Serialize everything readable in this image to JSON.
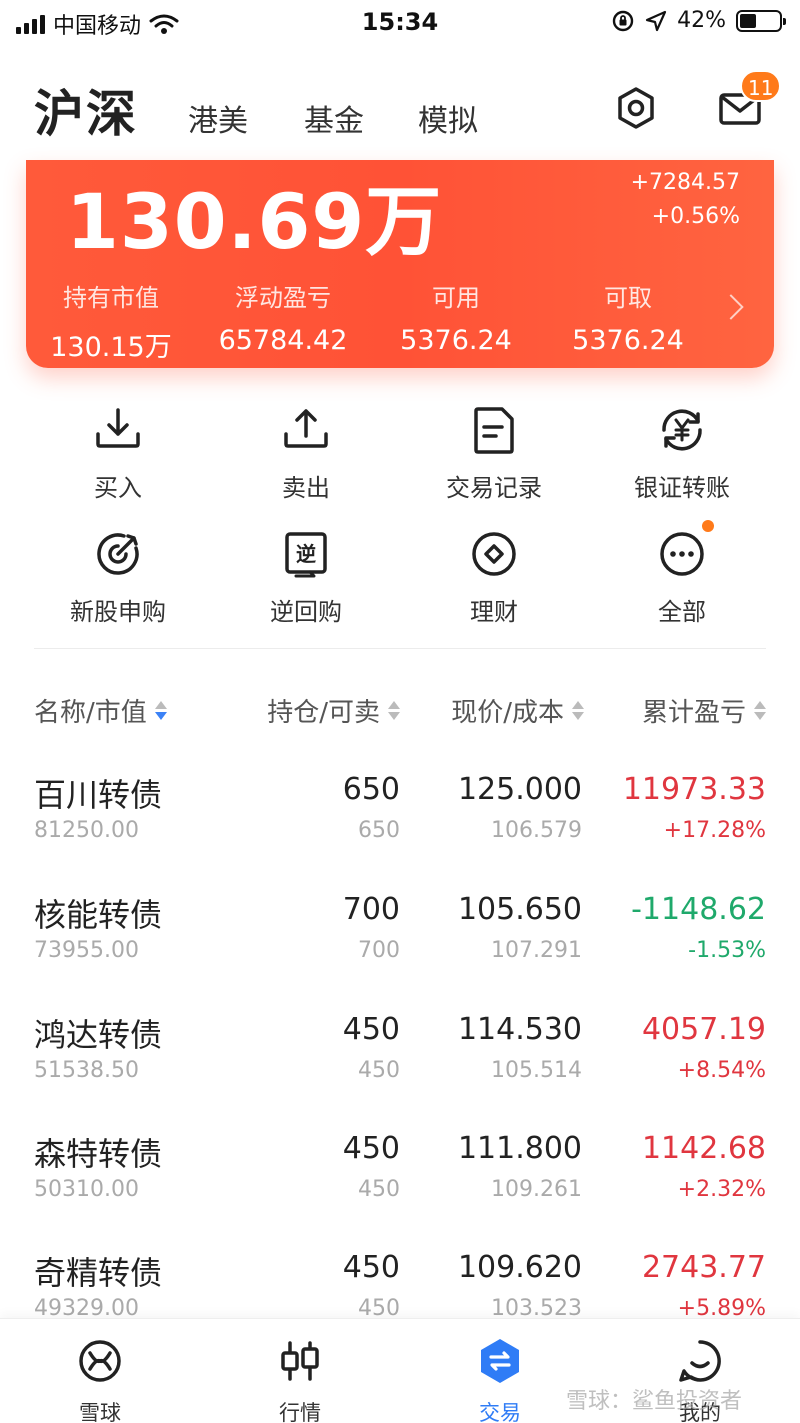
{
  "status_bar": {
    "carrier": "中国移动",
    "time": "15:34",
    "battery": "42%"
  },
  "header": {
    "active_tab": "沪深",
    "tabs": [
      "港美",
      "基金",
      "模拟"
    ],
    "mail_badge": "11"
  },
  "asset_card": {
    "total": "130.69万",
    "today_amount": "+7284.57",
    "today_percent": "+0.56%",
    "stats": [
      {
        "label": "持有市值",
        "value": "130.15万"
      },
      {
        "label": "浮动盈亏",
        "value": "65784.42"
      },
      {
        "label": "可用",
        "value": "5376.24"
      },
      {
        "label": "可取",
        "value": "5376.24"
      }
    ]
  },
  "actions": [
    {
      "label": "买入",
      "icon": "download-tray-icon"
    },
    {
      "label": "卖出",
      "icon": "upload-tray-icon"
    },
    {
      "label": "交易记录",
      "icon": "document-icon"
    },
    {
      "label": "银证转账",
      "icon": "yen-transfer-icon"
    },
    {
      "label": "新股申购",
      "icon": "target-icon"
    },
    {
      "label": "逆回购",
      "icon": "reverse-repo-icon"
    },
    {
      "label": "理财",
      "icon": "circle-diamond-icon"
    },
    {
      "label": "全部",
      "icon": "more-dots-icon"
    }
  ],
  "table": {
    "headers": [
      "名称/市值",
      "持仓/可卖",
      "现价/成本",
      "累计盈亏"
    ],
    "rows": [
      {
        "name": "百川转债",
        "market_value": "81250.00",
        "position": "650",
        "sellable": "650",
        "price": "125.000",
        "cost": "106.579",
        "pl": "11973.33",
        "pl_pct": "+17.28%",
        "pl_color": "#e0363f"
      },
      {
        "name": "核能转债",
        "market_value": "73955.00",
        "position": "700",
        "sellable": "700",
        "price": "105.650",
        "cost": "107.291",
        "pl": "-1148.62",
        "pl_pct": "-1.53%",
        "pl_color": "#1fa96b"
      },
      {
        "name": "鸿达转债",
        "market_value": "51538.50",
        "position": "450",
        "sellable": "450",
        "price": "114.530",
        "cost": "105.514",
        "pl": "4057.19",
        "pl_pct": "+8.54%",
        "pl_color": "#e0363f"
      },
      {
        "name": "森特转债",
        "market_value": "50310.00",
        "position": "450",
        "sellable": "450",
        "price": "111.800",
        "cost": "109.261",
        "pl": "1142.68",
        "pl_pct": "+2.32%",
        "pl_color": "#e0363f"
      },
      {
        "name": "奇精转债",
        "market_value": "49329.00",
        "position": "450",
        "sellable": "450",
        "price": "109.620",
        "cost": "103.523",
        "pl": "2743.77",
        "pl_pct": "+5.89%",
        "pl_color": "#e0363f"
      }
    ]
  },
  "bottom_nav": [
    {
      "label": "雪球",
      "icon": "snowball-icon"
    },
    {
      "label": "行情",
      "icon": "candlestick-icon"
    },
    {
      "label": "交易",
      "icon": "trade-hexagon-icon",
      "active": true
    },
    {
      "label": "我的",
      "icon": "profile-bubble-icon"
    }
  ],
  "watermark": "雪球：鲨鱼投资者",
  "colors": {
    "accent": "#ff5a3a",
    "nav_active": "#2f7cf6",
    "gain": "#e0363f",
    "loss": "#1fa96b"
  }
}
